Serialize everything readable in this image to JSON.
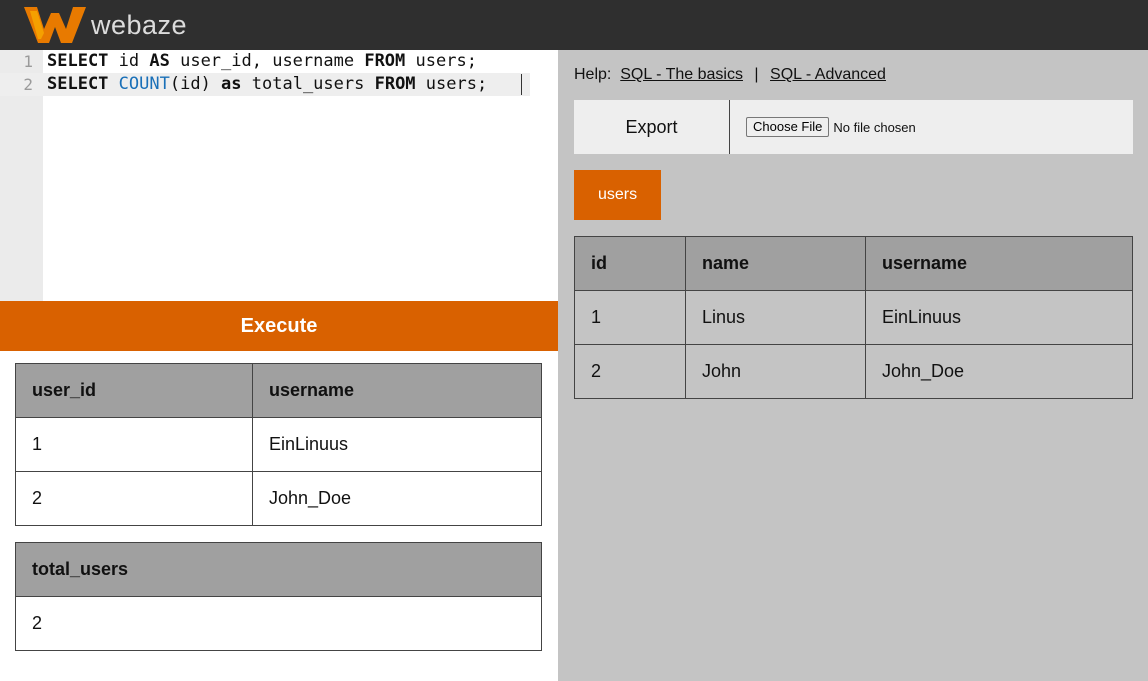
{
  "brand": {
    "name": "webaze",
    "logo_icon": "w-logo-icon",
    "logo_color": "#e87a00"
  },
  "editor": {
    "line_numbers": [
      "1",
      "2"
    ],
    "line1": {
      "k1": "SELECT",
      "t1": " id ",
      "k2": "AS",
      "t2": " user_id, username ",
      "k3": "FROM",
      "t3": " users;"
    },
    "line2": {
      "k1": "SELECT",
      "t1": " ",
      "fn": "COUNT",
      "t2": "(id) ",
      "k2": "as",
      "t3": " total_users ",
      "k3": "FROM",
      "t4": " users;"
    }
  },
  "execute_label": "Execute",
  "results": [
    {
      "headers": [
        "user_id",
        "username"
      ],
      "rows": [
        [
          "1",
          "EinLinuus"
        ],
        [
          "2",
          "John_Doe"
        ]
      ]
    },
    {
      "headers": [
        "total_users"
      ],
      "rows": [
        [
          "2"
        ]
      ]
    }
  ],
  "help": {
    "label": "Help:",
    "link1": "SQL - The basics",
    "separator": "|",
    "link2": "SQL - Advanced"
  },
  "toolbar": {
    "export_label": "Export",
    "choose_file": "Choose File",
    "no_file": "No file chosen"
  },
  "tables": {
    "active_tab": "users"
  },
  "users_table": {
    "headers": [
      "id",
      "name",
      "username"
    ],
    "rows": [
      [
        "1",
        "Linus",
        "EinLinuus"
      ],
      [
        "2",
        "John",
        "John_Doe"
      ]
    ]
  },
  "colors": {
    "accent": "#d96100",
    "topbar": "#2f2f2f",
    "panel": "#c4c4c4",
    "header_cell": "#a0a0a0"
  }
}
